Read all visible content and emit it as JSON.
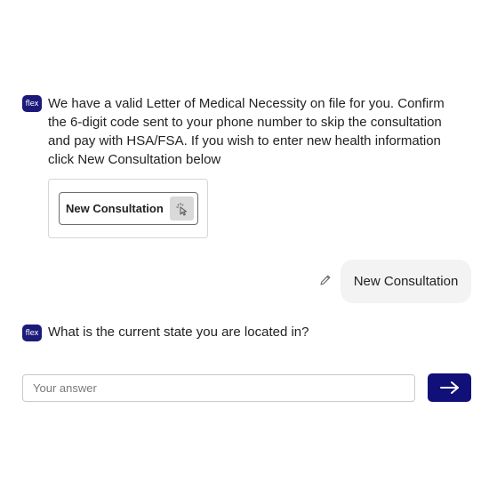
{
  "messages": [
    {
      "sender": "bot",
      "avatar_label": "flex",
      "text": "We have a valid Letter of Medical Necessity on file for you. Confirm the 6-digit code sent to your phone number to skip the consultation and pay with HSA/FSA. If you wish to enter new health information click New Consultation below",
      "action_button_label": "New Consultation"
    },
    {
      "sender": "user",
      "text": "New Consultation",
      "edit_icon": "pencil-icon"
    },
    {
      "sender": "bot",
      "avatar_label": "flex",
      "text": "What is the current state you are located in?"
    }
  ],
  "composer": {
    "placeholder": "Your answer",
    "value": "",
    "send_icon": "arrow-right-icon"
  },
  "colors": {
    "brand": "#1b1a7a",
    "send_button": "#110f78",
    "user_bubble": "#f3f3f3"
  }
}
